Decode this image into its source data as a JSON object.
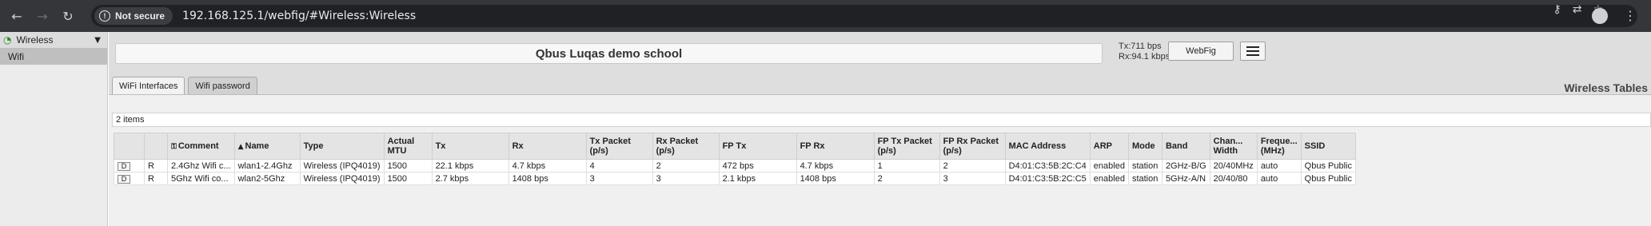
{
  "browser": {
    "security_label": "Not secure",
    "url": "192.168.125.1/webfig/#Wireless:Wireless"
  },
  "sidebar": {
    "header_label": "Wireless",
    "items": [
      {
        "label": "Wifi"
      }
    ]
  },
  "header": {
    "title": "Qbus Luqas demo school",
    "tx": "Tx:711 bps",
    "rx": "Rx:94.1 kbps",
    "webfig_label": "WebFig"
  },
  "tabs": [
    {
      "label": "WiFi Interfaces"
    },
    {
      "label": "Wifi password"
    }
  ],
  "section_title": "Wireless Tables",
  "table": {
    "count_text": "2 items",
    "columns": [
      "",
      "",
      "Comment",
      "Name",
      "Type",
      "Actual MTU",
      "Tx",
      "Rx",
      "Tx Packet (p/s)",
      "Rx Packet (p/s)",
      "FP Tx",
      "FP Rx",
      "FP Tx Packet (p/s)",
      "FP Rx Packet (p/s)",
      "MAC Address",
      "ARP",
      "Mode",
      "Band",
      "Chan... Width",
      "Freque... (MHz)",
      "SSID"
    ],
    "rows": [
      {
        "btn": "D",
        "flag": "R",
        "comment": "2.4Ghz Wifi c...",
        "name": "wlan1-2.4Ghz",
        "type": "Wireless (IPQ4019)",
        "mtu": "1500",
        "tx": "22.1 kbps",
        "rx": "4.7 kbps",
        "txp": "4",
        "rxp": "2",
        "fptx": "472 bps",
        "fprx": "4.7 kbps",
        "fptxp": "1",
        "fprxp": "2",
        "mac": "D4:01:C3:5B:2C:C4",
        "arp": "enabled",
        "mode": "station",
        "band": "2GHz-B/G",
        "chw": "20/40MHz",
        "freq": "auto",
        "ssid": "Qbus Public"
      },
      {
        "btn": "D",
        "flag": "R",
        "comment": "5Ghz Wifi co...",
        "name": "wlan2-5Ghz",
        "type": "Wireless (IPQ4019)",
        "mtu": "1500",
        "tx": "2.7 kbps",
        "rx": "1408 bps",
        "txp": "3",
        "rxp": "3",
        "fptx": "2.1 kbps",
        "fprx": "1408 bps",
        "fptxp": "2",
        "fprxp": "3",
        "mac": "D4:01:C3:5B:2C:C5",
        "arp": "enabled",
        "mode": "station",
        "band": "5GHz-A/N",
        "chw": "20/40/80",
        "freq": "auto",
        "ssid": "Qbus Public"
      }
    ]
  }
}
